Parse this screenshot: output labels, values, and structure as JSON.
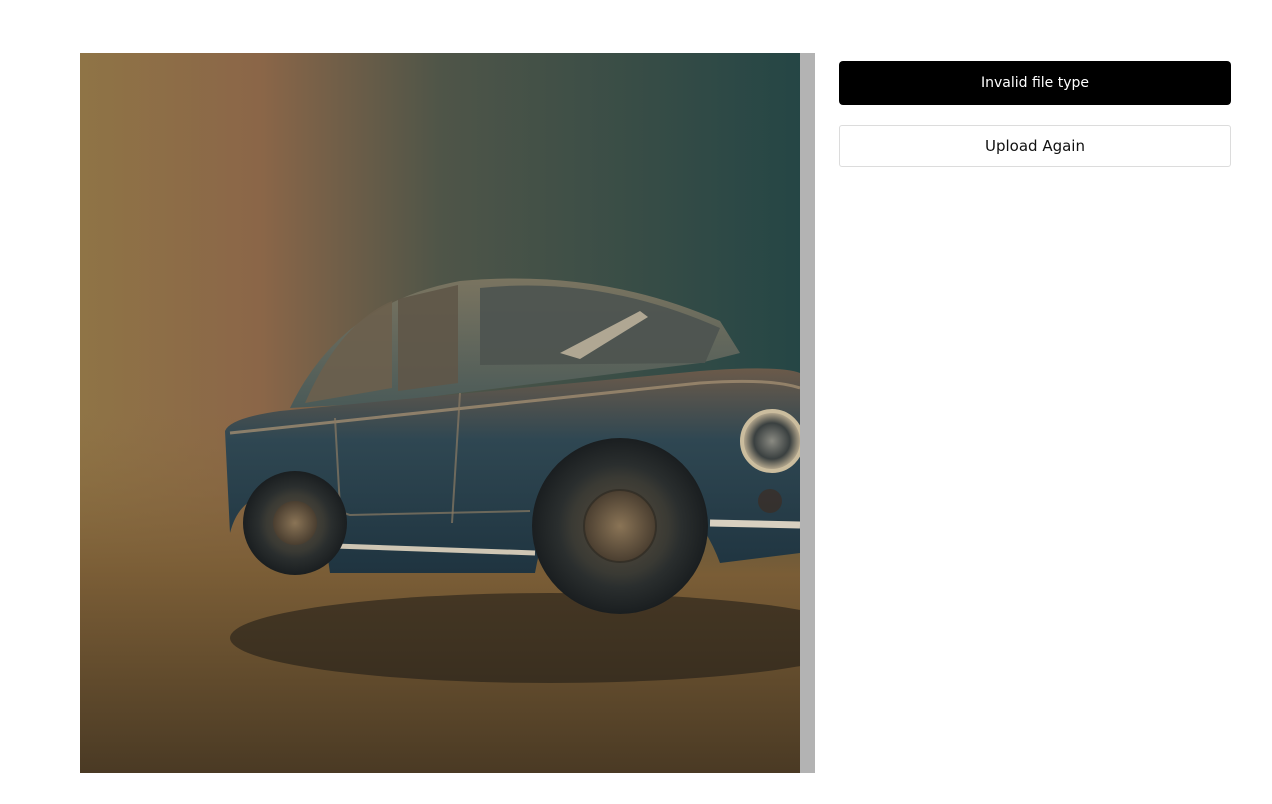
{
  "preview": {
    "subject": "vintage car illustration",
    "colors": {
      "background_warm": "#94764a",
      "background_cool": "#2a4a48",
      "car_body": "#2d4550",
      "floor": "#6e5532"
    }
  },
  "panel": {
    "status_label": "Invalid file type",
    "upload_again_label": "Upload Again"
  },
  "colors": {
    "status_bg": "#000000",
    "status_text": "#ffffff",
    "scrollbar": "#b3b3b3"
  }
}
